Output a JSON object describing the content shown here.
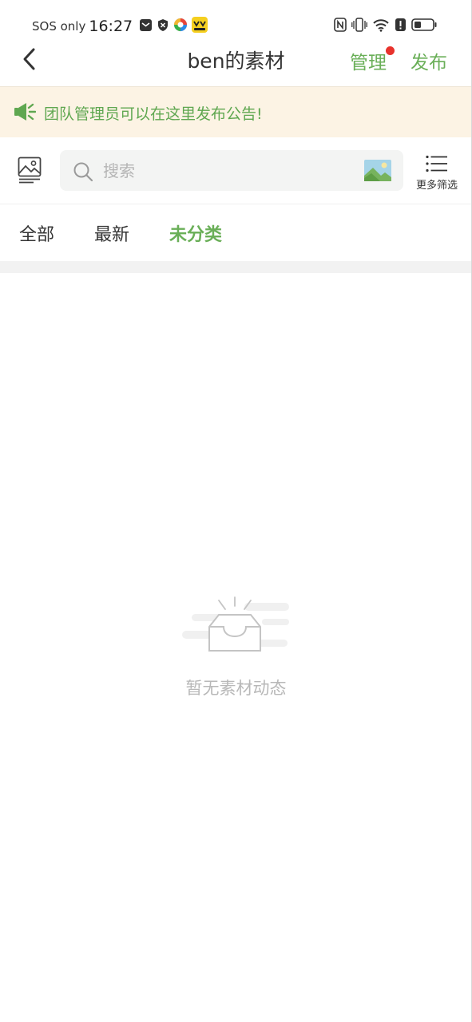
{
  "status_bar": {
    "carrier": "SOS only",
    "time": "16:27",
    "left_icons": [
      "mail-icon",
      "shield-x-icon",
      "browser-icon",
      "app-yellow-icon"
    ],
    "right_icons": [
      "nfc-icon",
      "vibrate-icon",
      "wifi-icon",
      "alert-icon",
      "battery-icon"
    ]
  },
  "nav": {
    "back_icon": "chevron-left-icon",
    "title": "ben的素材",
    "manage_label": "管理",
    "publish_label": "发布"
  },
  "announcement": {
    "icon": "megaphone-icon",
    "text": "团队管理员可以在这里发布公告!"
  },
  "search": {
    "placeholder": "搜索",
    "value": "",
    "gallery_icon": "gallery-icon",
    "image_search_icon": "image-search-icon",
    "filter_label": "更多筛选"
  },
  "tabs": [
    {
      "label": "全部",
      "active": false
    },
    {
      "label": "最新",
      "active": false
    },
    {
      "label": "未分类",
      "active": true
    }
  ],
  "empty_state": {
    "icon": "empty-inbox-icon",
    "text": "暂无素材动态"
  },
  "colors": {
    "accent_green": "#6aaf58",
    "announcement_bg": "#fcf3e4",
    "badge_red": "#e8322c",
    "muted_text": "#b8b8b8"
  }
}
